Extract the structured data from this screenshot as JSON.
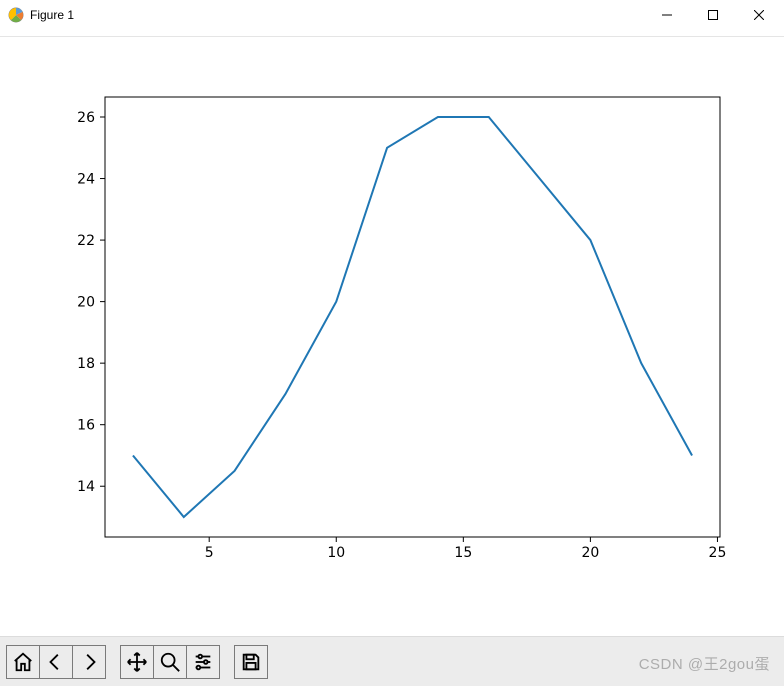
{
  "window": {
    "title": "Figure 1"
  },
  "toolbar": {
    "home": "Home",
    "back": "Back",
    "forward": "Forward",
    "pan": "Pan",
    "zoom": "Zoom",
    "configure": "Configure subplots",
    "save": "Save"
  },
  "watermark": "CSDN @王2gou蛋",
  "chart_data": {
    "type": "line",
    "x": [
      2,
      4,
      6,
      8,
      10,
      12,
      14,
      16,
      18,
      20,
      22,
      24
    ],
    "y": [
      15,
      13,
      14.5,
      17,
      20,
      25,
      26,
      26,
      24,
      22,
      18,
      15
    ],
    "x_ticks": [
      5,
      10,
      15,
      20,
      25
    ],
    "y_ticks": [
      14,
      16,
      18,
      20,
      22,
      24,
      26
    ],
    "xlim": [
      0.9,
      25.1
    ],
    "ylim": [
      12.35,
      26.65
    ],
    "line_color": "#1f77b4",
    "title": "",
    "xlabel": "",
    "ylabel": ""
  }
}
